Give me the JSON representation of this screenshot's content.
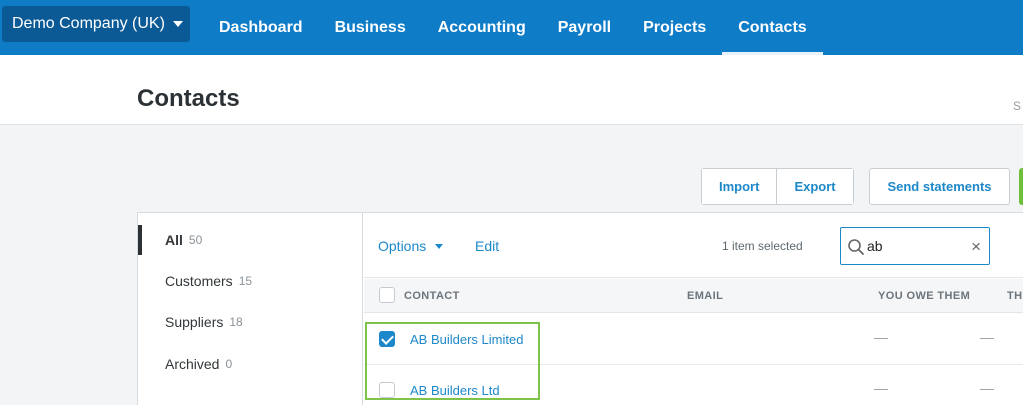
{
  "topbar": {
    "org_name": "Demo Company (UK)",
    "nav": [
      "Dashboard",
      "Business",
      "Accounting",
      "Payroll",
      "Projects",
      "Contacts"
    ],
    "active_index": 5
  },
  "header": {
    "title": "Contacts",
    "right_glyph": "S"
  },
  "actions": {
    "import_label": "Import",
    "export_label": "Export",
    "send_statements_label": "Send statements"
  },
  "sidebar": {
    "items": [
      {
        "label": "All",
        "count": "50"
      },
      {
        "label": "Customers",
        "count": "15"
      },
      {
        "label": "Suppliers",
        "count": "18"
      },
      {
        "label": "Archived",
        "count": "0"
      }
    ]
  },
  "toolbar": {
    "options_label": "Options",
    "edit_label": "Edit",
    "selected_text": "1 item selected",
    "search_value": "ab",
    "clear_icon": "×"
  },
  "table": {
    "columns": [
      "CONTACT",
      "EMAIL",
      "YOU OWE THEM",
      "THI"
    ],
    "rows": [
      {
        "name": "AB Builders Limited",
        "checked": true,
        "email": "",
        "you_owe": "—",
        "they_owe": "—"
      },
      {
        "name": "AB Builders Ltd",
        "checked": false,
        "email": "",
        "you_owe": "—",
        "they_owe": "—"
      }
    ]
  },
  "colors": {
    "nav_blue": "#0f7cc8",
    "link_blue": "#1d88c9",
    "highlight_green": "#7ec34a"
  }
}
